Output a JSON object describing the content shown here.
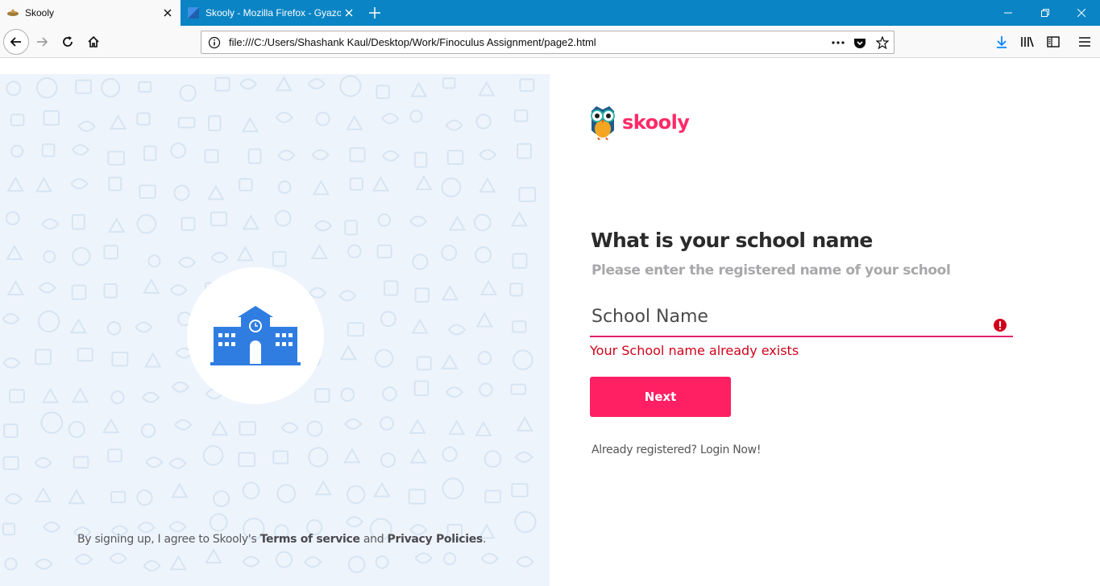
{
  "browser": {
    "tabs": [
      {
        "title": "Skooly",
        "active": true
      },
      {
        "title": "Skooly - Mozilla Firefox - Gyazo",
        "active": false
      }
    ],
    "url": "file:///C:/Users/Shashank Kaul/Desktop/Work/Finoculus Assignment/page2.html",
    "accent_color": "#0a84c4"
  },
  "page": {
    "logo_text": "skooly",
    "heading": "What is your school name",
    "subheading": "Please enter the registered name of your school",
    "school_name_placeholder": "School Name",
    "school_name_value": "",
    "error_message": "Your School name already exists",
    "next_button": "Next",
    "login_prompt": "Already registered?",
    "login_link": "Login Now!",
    "terms": {
      "prefix": "By signing up, I agree to Skooly's",
      "terms_link": "Terms of service",
      "and": "and",
      "privacy_link": "Privacy Policies",
      "suffix": "."
    },
    "colors": {
      "brand": "#ff2a68",
      "button": "#ff1f63",
      "error": "#d0021b",
      "left_panel_bg": "#eef4fb",
      "school_icon": "#2f7de1"
    },
    "icons": {
      "school": "school-building-icon",
      "error": "exclamation-circle-icon",
      "logo": "owl-logo-icon"
    }
  }
}
